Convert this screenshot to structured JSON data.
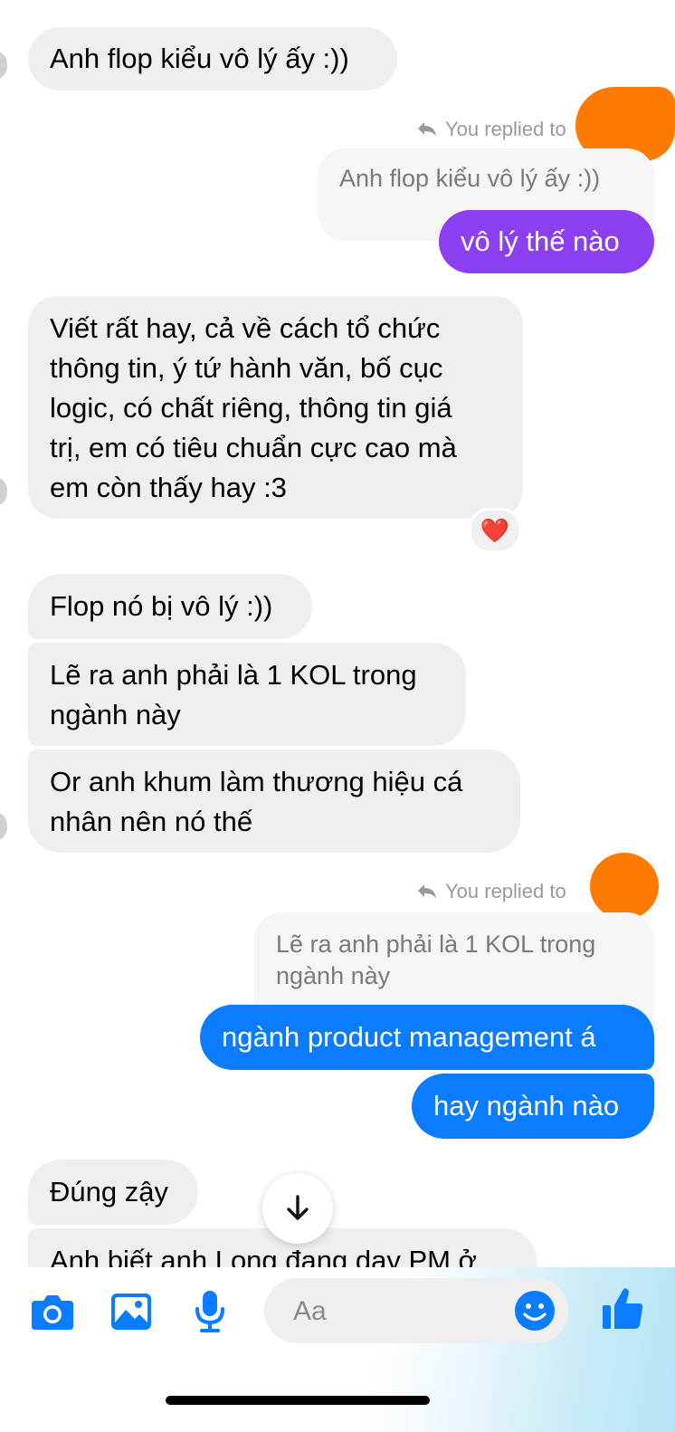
{
  "messages": {
    "m1": "Anh flop kiểu vô lý ấy :))",
    "reply1_label": "You replied to",
    "reply1_quote": "Anh flop kiểu vô lý ấy :))",
    "m2": "vô lý thế nào",
    "m3": "Viết rất hay, cả về cách tổ chức\nthông tin, ý tứ hành văn, bố cục\nlogic, có chất riêng, thông tin giá\ntrị, em có tiêu chuẩn cực cao mà\nem còn thấy hay :3",
    "m3_reaction": "❤️",
    "m4": "Flop nó bị vô lý :))",
    "m5": "Lẽ ra anh phải là 1 KOL trong\nngành này",
    "m6": "Or anh khum làm thương hiệu cá\nnhân nên nó thế",
    "reply2_label": "You replied to",
    "reply2_quote": "Lẽ ra anh phải là 1 KOL trong\nngành này",
    "m7": "ngành product management á",
    "m8": "hay ngành nào",
    "m9": "Đúng zậy",
    "m10": "Anh biết anh Long đang dạy PM ở"
  },
  "composer": {
    "placeholder": "Aa",
    "icons": [
      "camera-icon",
      "image-icon",
      "microphone-icon",
      "emoji-icon",
      "thumbs-up-icon"
    ]
  },
  "colors": {
    "incoming": "#efefef",
    "outgoing_purple": "#8b3ff0",
    "outgoing_blue": "#0a7cff",
    "accent": "#0a7cff",
    "redaction": "#ff7a00"
  }
}
